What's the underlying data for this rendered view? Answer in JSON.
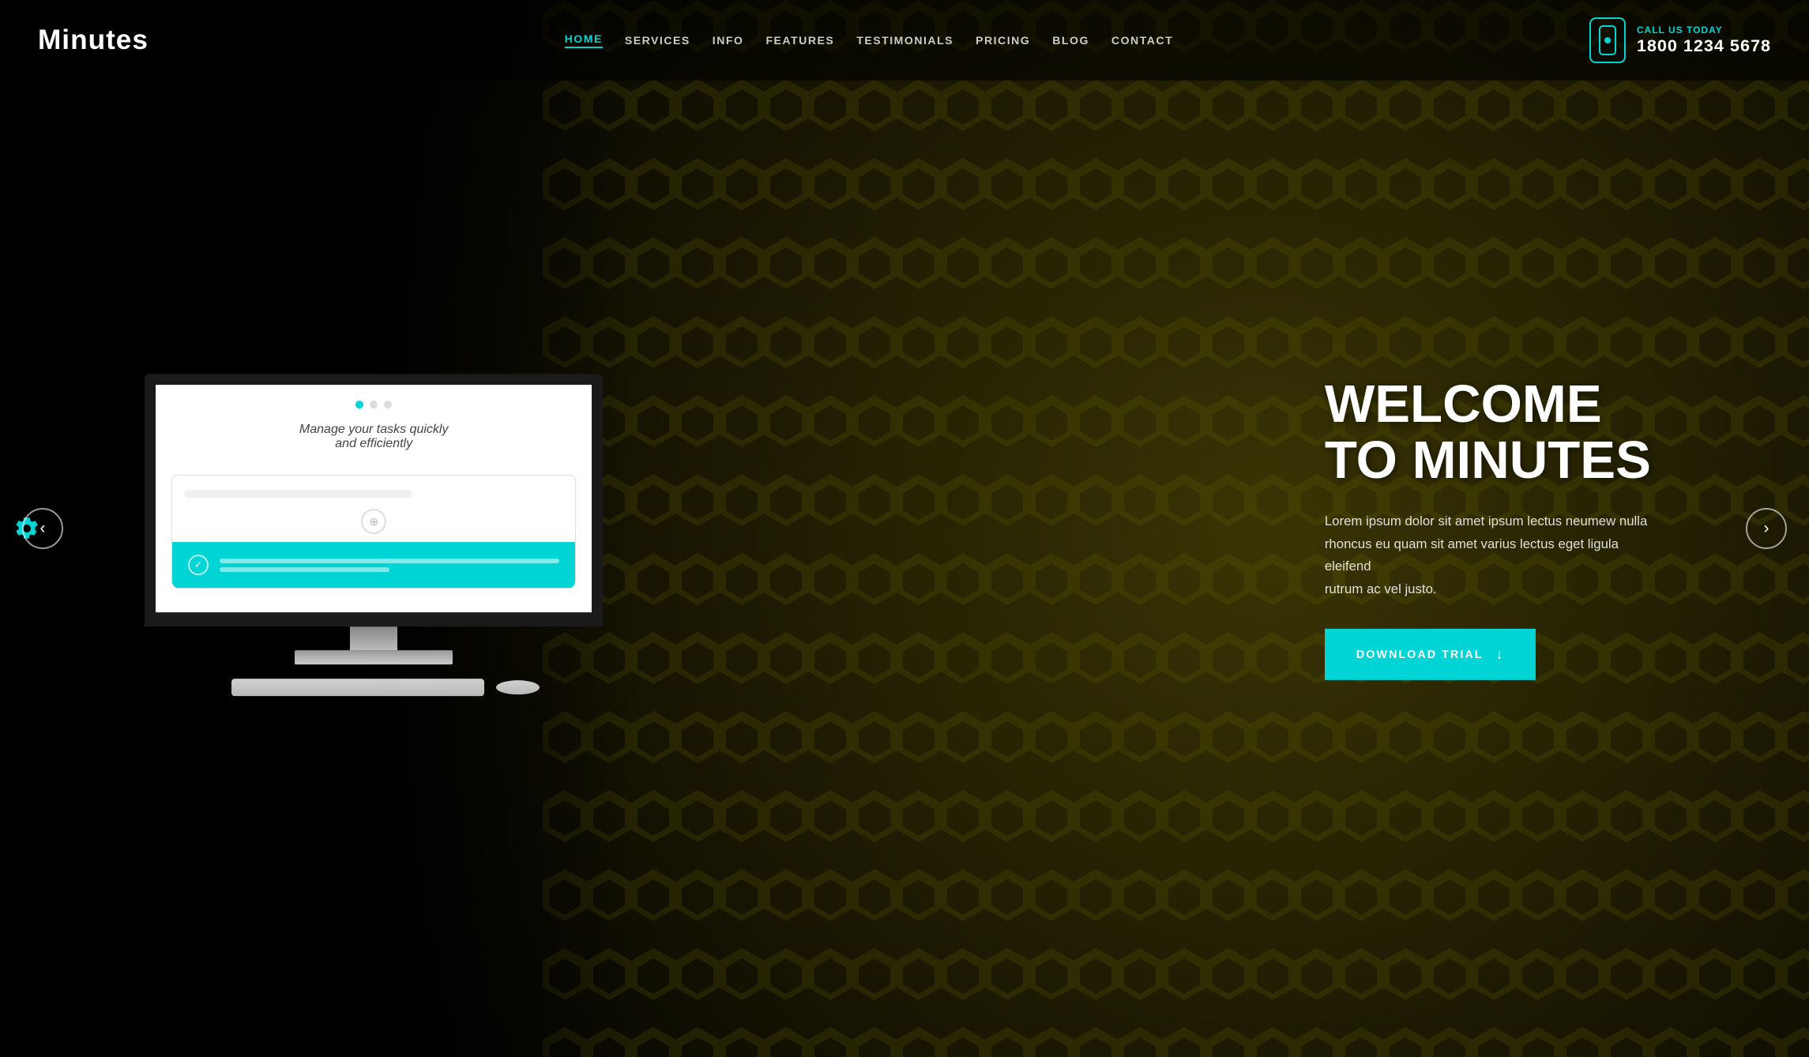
{
  "header": {
    "logo": "Minutes",
    "nav": [
      {
        "label": "HOME",
        "active": true
      },
      {
        "label": "SERVICES",
        "active": false
      },
      {
        "label": "INFO",
        "active": false
      },
      {
        "label": "FEATURES",
        "active": false
      },
      {
        "label": "TESTIMONIALS",
        "active": false
      },
      {
        "label": "PRICING",
        "active": false
      },
      {
        "label": "BLOG",
        "active": false
      },
      {
        "label": "CONTACT",
        "active": false
      }
    ],
    "call_label": "CALL US TODAY",
    "call_number": "1800 1234 5678"
  },
  "hero": {
    "title_line1": "WELCOME",
    "title_line2": "TO MINUTES",
    "description": "Lorem ipsum dolor sit amet ipsum lectus neumew nulla rhoncus eu quam sit amet varius lectus eget ligula eleifend\nrutrum ac vel justo.",
    "cta_label": "DOWNLOAD TRIAL",
    "screen_text": "Manage your tasks quickly\nand efficiently",
    "carousel_prev": "‹",
    "carousel_next": "›"
  }
}
